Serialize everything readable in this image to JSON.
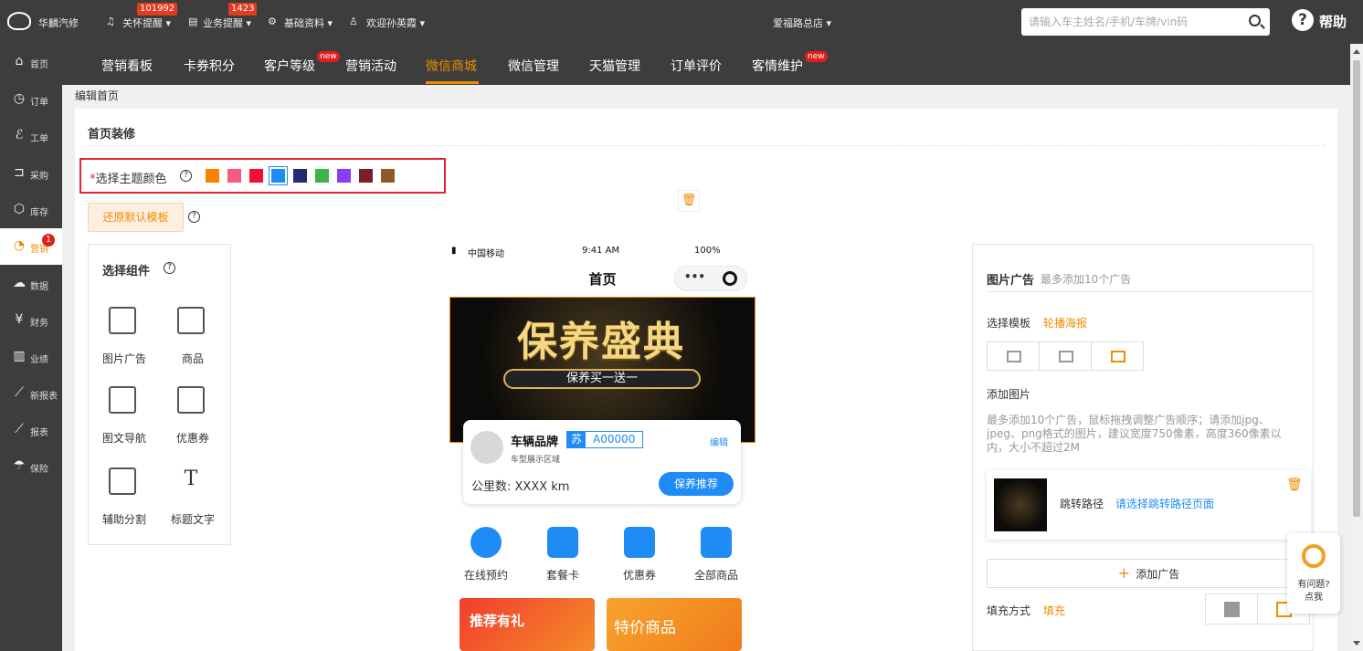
{
  "topbar": {
    "brand": "华麟汽修",
    "care_label": "关怀提醒",
    "care_badge": "101992",
    "biz_label": "业务提醒",
    "biz_badge": "1423",
    "basic_label": "基础资料",
    "welcome": "欢迎孙英霞",
    "store": "爱福路总店",
    "search_placeholder": "请输入车主姓名/手机/车牌/vin码",
    "help": "帮助"
  },
  "sidebar": {
    "items": [
      {
        "label": "首页",
        "icon": "home-icon"
      },
      {
        "label": "订单",
        "icon": "clock-icon"
      },
      {
        "label": "工单",
        "icon": "wrench-icon"
      },
      {
        "label": "采购",
        "icon": "cart-icon"
      },
      {
        "label": "库存",
        "icon": "box-icon"
      },
      {
        "label": "营销",
        "icon": "pie-icon",
        "badge": "1",
        "active": true
      },
      {
        "label": "数据",
        "icon": "cloud-icon"
      },
      {
        "label": "财务",
        "icon": "yen-icon"
      },
      {
        "label": "业绩",
        "icon": "bar-chart-icon"
      },
      {
        "label": "新报表",
        "icon": "line-chart-icon"
      },
      {
        "label": "报表",
        "icon": "line-chart-icon"
      },
      {
        "label": "保险",
        "icon": "umbrella-icon"
      }
    ]
  },
  "nav": {
    "items": [
      "营销看板",
      "卡券积分",
      "客户等级",
      "营销活动",
      "微信商城",
      "微信管理",
      "天猫管理",
      "订单评价",
      "客情维护"
    ],
    "new_badge": "new",
    "active": "微信商城"
  },
  "breadcrumb": "编辑首页",
  "panel": {
    "title": "首页装修",
    "theme_label": "选择主题颜色",
    "theme_required": "*",
    "theme_colors": [
      "#fa8000",
      "#f45a82",
      "#f10f32",
      "#1f8cf5",
      "#242b6e",
      "#3cb44b",
      "#8b3ef2",
      "#7c1d2b",
      "#8d5a2b"
    ],
    "theme_selected": "#1f8cf5",
    "restore_button": "还原默认模板"
  },
  "components": {
    "title": "选择组件",
    "items": [
      "图片广告",
      "商品",
      "图文导航",
      "优惠券",
      "辅助分割",
      "标题文字"
    ]
  },
  "phone": {
    "carrier": "中国移动",
    "time": "9:41 AM",
    "battery": "100%",
    "title": "首页",
    "banner_big": "保养盛典",
    "banner_small": "保养买一送一",
    "car_brand": "车辆品牌",
    "plate_prov": "苏",
    "plate_num": "A00000",
    "car_edit": "编辑",
    "car_model": "车型展示区域",
    "mileage": "公里数:  XXXX km",
    "maint_button": "保养推荐",
    "quick": [
      "在线预约",
      "套餐卡",
      "优惠券",
      "全部商品"
    ],
    "promo_left": "推荐有礼",
    "promo_right": "特价商品"
  },
  "ad_settings": {
    "title": "图片广告",
    "subtitle": "最多添加10个广告",
    "template_label": "选择模板",
    "template_value": "轮播海报",
    "add_image_label": "添加图片",
    "add_image_tip": "最多添加10个广告，鼠标拖拽调整广告顺序；请添加jpg、jpeg、png格式的图片，建议宽度750像素，高度360像素以内，大小不超过2M",
    "path_label": "跳转路径",
    "path_value": "请选择跳转路径页面",
    "add_ad": "添加广告",
    "fill_label": "填充方式",
    "fill_value": "填充"
  },
  "float_help": {
    "line1": "有问题?",
    "line2": "点我"
  }
}
